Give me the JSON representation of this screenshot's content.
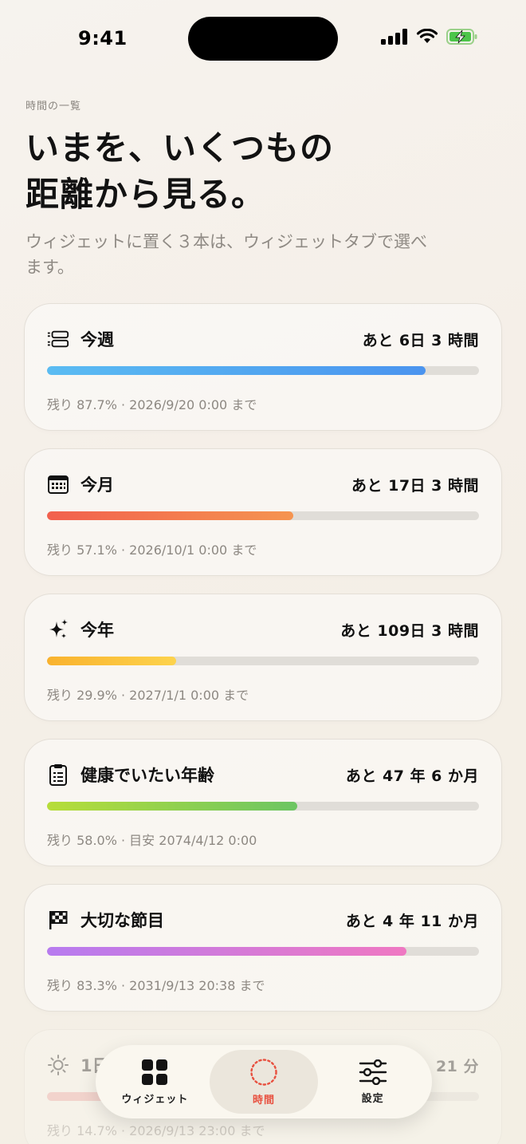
{
  "status": {
    "time": "9:41"
  },
  "header": {
    "eyebrow": "時間の一覧",
    "title_line1": "いまを、いくつもの",
    "title_line2": "距離から見る。",
    "subtitle": "ウィジェットに置く３本は、ウィジェットタブで選べます。"
  },
  "cards": [
    {
      "icon": "week-strips-icon",
      "title": "今週",
      "remaining": "あと 6日 3 時間",
      "progress": 0.877,
      "gradient": [
        "#5bbcf2",
        "#4b94ef"
      ],
      "detail": "残り 87.7% · 2026/9/20 0:00 まで"
    },
    {
      "icon": "calendar-icon",
      "title": "今月",
      "remaining": "あと 17日 3 時間",
      "progress": 0.571,
      "gradient": [
        "#f2604e",
        "#f59450"
      ],
      "detail": "残り 57.1% · 2026/10/1 0:00 まで"
    },
    {
      "icon": "sparkles-icon",
      "title": "今年",
      "remaining": "あと 109日 3 時間",
      "progress": 0.299,
      "gradient": [
        "#f9b22e",
        "#fdd34d"
      ],
      "detail": "残り 29.9% · 2027/1/1 0:00 まで"
    },
    {
      "icon": "clipboard-icon",
      "title": "健康でいたい年齢",
      "remaining": "あと 47 年 6 か月",
      "progress": 0.58,
      "gradient": [
        "#b7dd3a",
        "#6cc563"
      ],
      "detail": "残り 58.0% · 目安 2074/4/12 0:00"
    },
    {
      "icon": "checkered-flag-icon",
      "title": "大切な節目",
      "remaining": "あと 4 年 11 か月",
      "progress": 0.833,
      "gradient": [
        "#b77bef",
        "#ef78c2"
      ],
      "detail": "残り 83.3% · 2031/9/13 20:38 まで"
    },
    {
      "icon": "sun-icon",
      "title": "1日",
      "remaining": "21 分",
      "progress": 0.147,
      "gradient": [
        "#f0a0a0",
        "#f0a0a0"
      ],
      "detail": "残り 14.7% · 2026/9/13 23:00 まで"
    }
  ],
  "tabbar": {
    "tabs": [
      {
        "label": "ウィジェット",
        "icon": "grid-icon",
        "active": false
      },
      {
        "label": "時間",
        "icon": "dotted-circle-icon",
        "active": true
      },
      {
        "label": "設定",
        "icon": "sliders-icon",
        "active": false
      }
    ],
    "active_color": "#e8503f"
  }
}
